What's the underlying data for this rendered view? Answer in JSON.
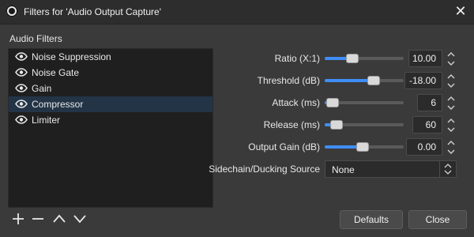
{
  "window": {
    "title": "Filters for 'Audio Output Capture'"
  },
  "sidebar": {
    "section_label": "Audio Filters",
    "filters": [
      {
        "label": "Noise Suppression",
        "visible": true,
        "selected": false
      },
      {
        "label": "Noise Gate",
        "visible": true,
        "selected": false
      },
      {
        "label": "Gain",
        "visible": true,
        "selected": false
      },
      {
        "label": "Compressor",
        "visible": true,
        "selected": true
      },
      {
        "label": "Limiter",
        "visible": true,
        "selected": false
      }
    ],
    "toolbar": [
      "add-icon",
      "remove-icon",
      "move-up-icon",
      "move-down-icon"
    ]
  },
  "properties": {
    "ratio": {
      "label": "Ratio (X:1)",
      "value": "10.00",
      "slider_fraction": 0.32
    },
    "threshold": {
      "label": "Threshold (dB)",
      "value": "-18.00",
      "slider_fraction": 0.64
    },
    "attack": {
      "label": "Attack (ms)",
      "value": "6",
      "slider_fraction": 0.02
    },
    "release": {
      "label": "Release (ms)",
      "value": "60",
      "slider_fraction": 0.08
    },
    "output_gain": {
      "label": "Output Gain (dB)",
      "value": "0.00",
      "slider_fraction": 0.48
    },
    "sidechain": {
      "label": "Sidechain/Ducking Source",
      "value": "None"
    }
  },
  "buttons": {
    "defaults": "Defaults",
    "close": "Close"
  },
  "colors": {
    "accent": "#3f8ef5",
    "selection": "#233447",
    "list_bg": "#1f1f1f",
    "window_bg": "#3a3a3a"
  }
}
